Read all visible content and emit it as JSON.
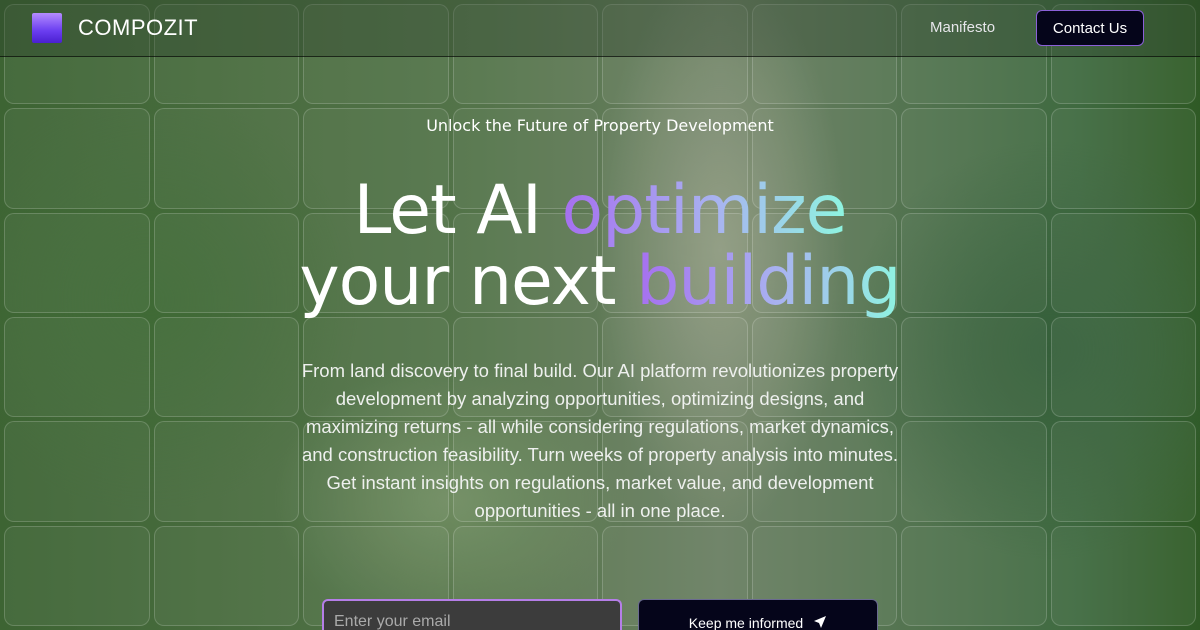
{
  "nav": {
    "brand": "COMPOZIT",
    "manifesto": "Manifesto",
    "contact": "Contact Us"
  },
  "hero": {
    "eyebrow": "Unlock the Future of Property Development",
    "line1_plain": "Let AI ",
    "line1_accent": "optimize",
    "line2_plain": "your next ",
    "line2_accent": "building",
    "paragraph": "From land discovery to final build. Our AI platform revolutionizes property development by analyzing opportunities, optimizing designs, and maximizing returns - all while considering regulations, market dynamics, and construction feasibility. Turn weeks of property analysis into minutes. Get instant insights on regulations, market value, and development opportunities - all in one place."
  },
  "signup": {
    "email_placeholder": "Enter your email",
    "button": "Keep me informed",
    "button_icon": "send-arrow-icon"
  },
  "colors": {
    "accent_start": "#a66ff0",
    "accent_end": "#8ef5e0",
    "button_bg": "#05051a"
  }
}
